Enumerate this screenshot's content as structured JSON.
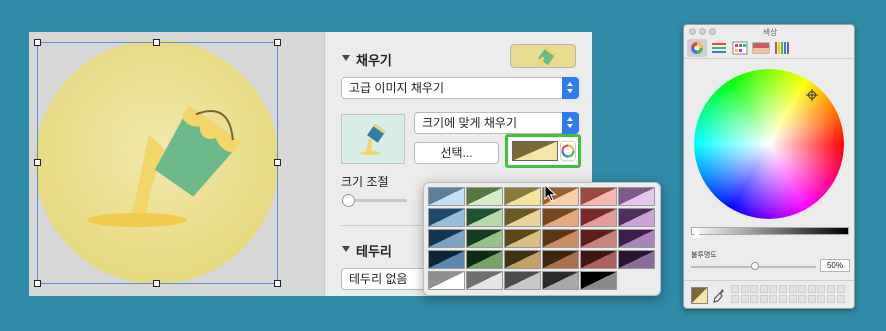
{
  "inspector": {
    "fill_section_title": "채우기",
    "fill_type_value": "고급 이미지 채우기",
    "scale_mode_value": "크기에 맞게 채우기",
    "choose_button": "선택...",
    "adjust_size_label": "크기 조절",
    "border_section_title": "테두리",
    "border_type_value": "테두리 없음"
  },
  "tint_color": "#7a6838",
  "swatch_palette": [
    [
      "#c4e0f5",
      "#5a7f9f"
    ],
    [
      "#d8ecc8",
      "#557a40"
    ],
    [
      "#f5e3a0",
      "#8a7a3c"
    ],
    [
      "#f8cfa8",
      "#9a6232"
    ],
    [
      "#f3b8b0",
      "#9a4a40"
    ],
    [
      "#e4c7ea",
      "#7e5a8a"
    ],
    [
      "#97bddc",
      "#1e4a70"
    ],
    [
      "#b9d9a9",
      "#1f5430"
    ],
    [
      "#e8d398",
      "#6e5a26"
    ],
    [
      "#e6a97e",
      "#7a4620"
    ],
    [
      "#e59c98",
      "#7a2a28"
    ],
    [
      "#caa4d6",
      "#4f2e60"
    ],
    [
      "#7da3c4",
      "#123553"
    ],
    [
      "#98c18a",
      "#133f20"
    ],
    [
      "#d9c082",
      "#5a4818"
    ],
    [
      "#cd8d63",
      "#5e3616"
    ],
    [
      "#cb817c",
      "#5c1f1c"
    ],
    [
      "#a983b9",
      "#3b1f48"
    ],
    [
      "#5c86ad",
      "#0c2538"
    ],
    [
      "#76a368",
      "#0c2c14"
    ],
    [
      "#bfa365",
      "#3f3210"
    ],
    [
      "#a8704c",
      "#3f2410"
    ],
    [
      "#a9625e",
      "#3e1614"
    ],
    [
      "#8c6b9b",
      "#281532"
    ],
    [
      "#ffffff",
      "#8f8f8f"
    ],
    [
      "#e6e6e6",
      "#6f6f6f"
    ],
    [
      "#c8c8c8",
      "#4d4d4d"
    ],
    [
      "#a8a8a8",
      "#2b2b2b"
    ],
    [
      "#8a8a8a",
      "#000000"
    ]
  ],
  "colors_window": {
    "title": "색상",
    "opacity_label": "불투명도",
    "opacity_value": "50%"
  }
}
